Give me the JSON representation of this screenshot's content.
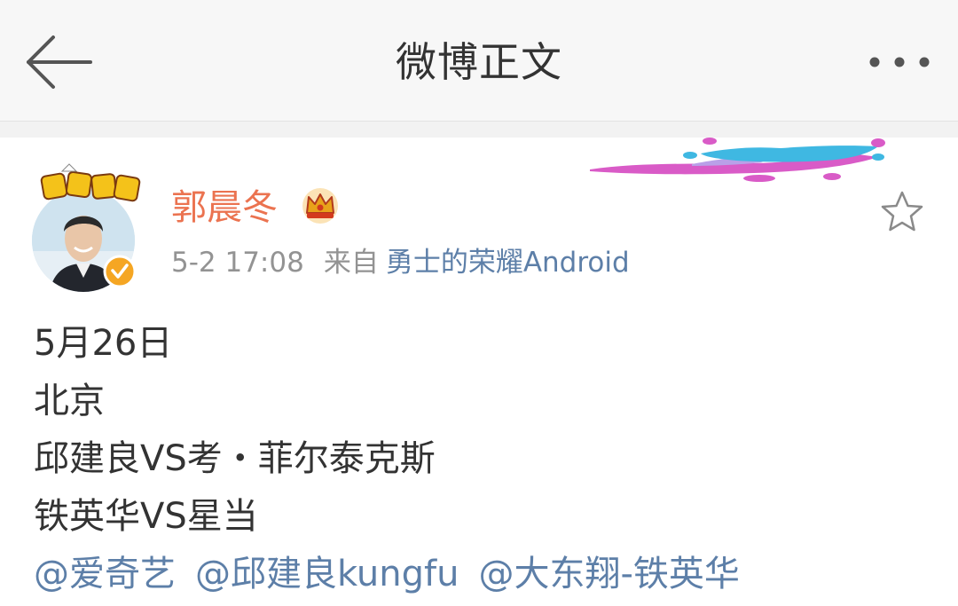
{
  "header": {
    "title": "微博正文"
  },
  "post": {
    "author": "郭晨冬",
    "time": "5-2 17:08",
    "from_label": "来自",
    "source": "勇士的荣耀Android",
    "lines": [
      "5月26日",
      "北京",
      "邱建良VS考・菲尔泰克斯",
      "铁英华VS星当"
    ],
    "mentions": [
      "@爱奇艺",
      "@邱建良kungfu",
      "@大东翔-铁英华"
    ]
  },
  "colors": {
    "username": "#eb7350",
    "link": "#5d7fa8",
    "meta_gray": "#939393",
    "verified_badge": "#f5a623",
    "header_bg": "#f7f7f7"
  },
  "icons": {
    "back": "back-arrow-icon",
    "more": "more-dots-icon",
    "favorite": "star-icon",
    "member": "crown-icon",
    "verified": "verified-v-icon"
  }
}
